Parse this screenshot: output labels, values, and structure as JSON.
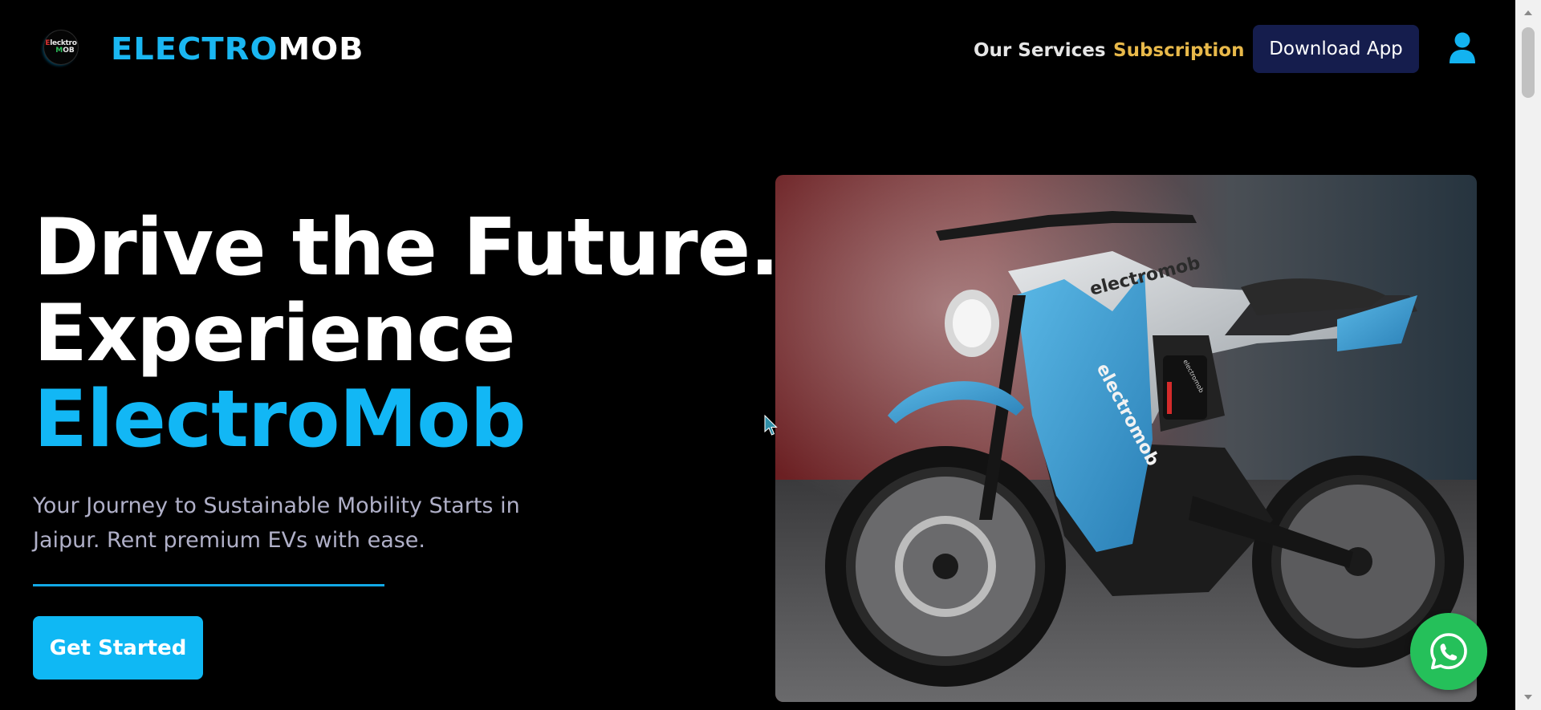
{
  "header": {
    "logo_badge": {
      "line1_first": "E",
      "line1_rest": "lecktro",
      "line2_first": "M",
      "line2_rest": "OB"
    },
    "brand_part1": "ELECTRO",
    "brand_part2": "MOB",
    "nav": {
      "services": "Our Services",
      "subscription": "Subscription"
    },
    "download_label": "Download App",
    "user_icon": "user-icon"
  },
  "hero": {
    "title_line1": "Drive the Future.",
    "title_line2": "Experience",
    "title_line3": "ElectroMob",
    "subtitle": "Your Journey to Sustainable Mobility Starts in Jaipur. Rent premium EVs with ease.",
    "cta_label": "Get Started",
    "image_text_tank": "electromob",
    "image_text_side": "electromob",
    "image_text_battery": "electromob"
  },
  "floating": {
    "whatsapp_icon": "whatsapp-icon"
  },
  "colors": {
    "accent": "#12b7f5",
    "subscription": "#e8b94a",
    "download_bg": "#151d4d",
    "whatsapp": "#25c05a",
    "background": "#000000"
  }
}
